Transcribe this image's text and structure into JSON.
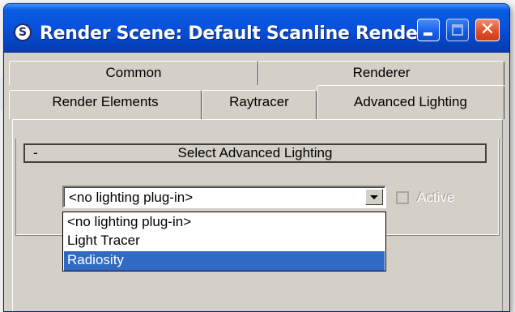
{
  "window": {
    "title": "Render Scene: Default Scanline Rende...",
    "icon": "3ds-max-app-icon",
    "controls": [
      "minimize-icon",
      "maximize-icon",
      "close-icon"
    ],
    "close_glyph": "✕"
  },
  "tabs": {
    "row1": [
      {
        "label": "Common"
      },
      {
        "label": "Renderer"
      }
    ],
    "row2": [
      {
        "label": "Render Elements"
      },
      {
        "label": "Raytracer"
      },
      {
        "label": "Advanced Lighting",
        "active": true
      }
    ]
  },
  "rollout": {
    "toggle": "-",
    "title": "Select Advanced Lighting"
  },
  "lighting_select": {
    "value": "<no lighting plug-in>",
    "options": [
      {
        "label": "<no lighting plug-in>"
      },
      {
        "label": "Light Tracer"
      },
      {
        "label": "Radiosity",
        "highlighted": true
      }
    ],
    "highlight_color": "#316ac5"
  },
  "active_checkbox": {
    "label": "Active",
    "checked": false,
    "enabled": false
  }
}
